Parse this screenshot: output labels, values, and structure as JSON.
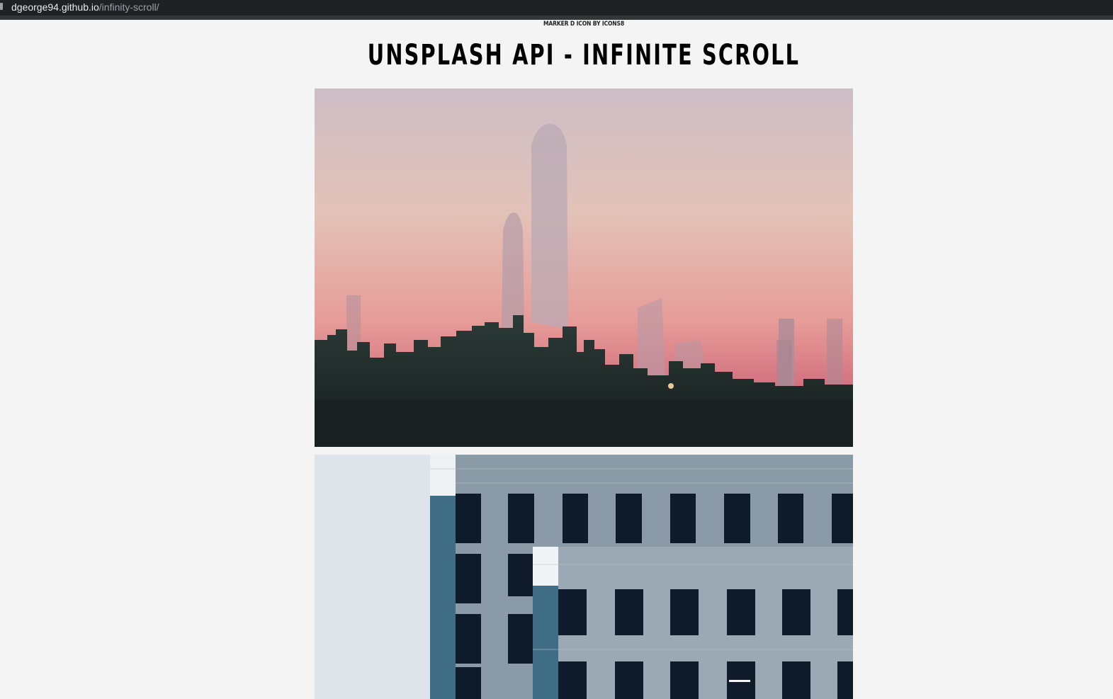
{
  "browser": {
    "url_host": "dgeorge94.github.io",
    "url_path": "/infinity-scroll/"
  },
  "page": {
    "credit": "MARKER D ICON BY ICONS8",
    "title": "UNSPLASH API - INFINITE SCROLL"
  },
  "photos": [
    {
      "subject": "city skyline at sunset"
    },
    {
      "subject": "grey office building facade"
    }
  ]
}
